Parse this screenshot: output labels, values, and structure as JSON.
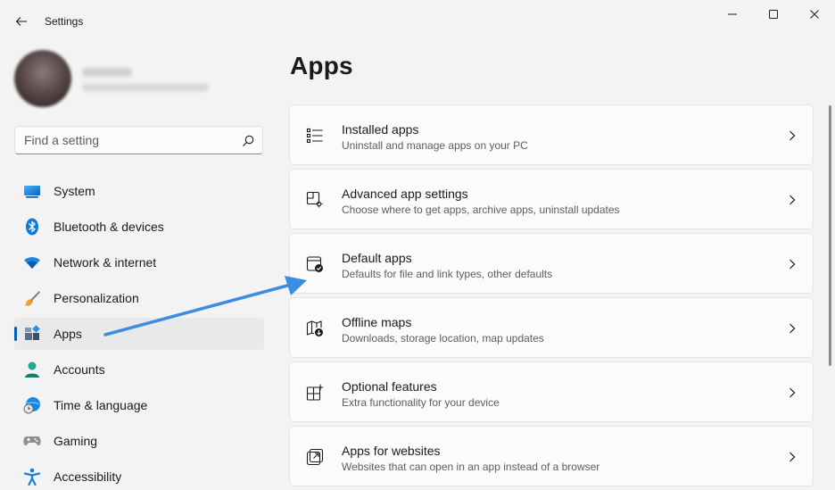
{
  "window": {
    "title": "Settings"
  },
  "search": {
    "placeholder": "Find a setting"
  },
  "sidebar": {
    "items": [
      {
        "label": "System",
        "icon": "monitor-icon"
      },
      {
        "label": "Bluetooth & devices",
        "icon": "bluetooth-icon"
      },
      {
        "label": "Network & internet",
        "icon": "wifi-icon"
      },
      {
        "label": "Personalization",
        "icon": "brush-icon"
      },
      {
        "label": "Apps",
        "icon": "apps-icon",
        "selected": true
      },
      {
        "label": "Accounts",
        "icon": "person-icon"
      },
      {
        "label": "Time & language",
        "icon": "globe-clock-icon"
      },
      {
        "label": "Gaming",
        "icon": "gamepad-icon"
      },
      {
        "label": "Accessibility",
        "icon": "accessibility-icon"
      }
    ]
  },
  "main": {
    "title": "Apps",
    "cards": [
      {
        "title": "Installed apps",
        "description": "Uninstall and manage apps on your PC",
        "icon": "list-icon"
      },
      {
        "title": "Advanced app settings",
        "description": "Choose where to get apps, archive apps, uninstall updates",
        "icon": "app-settings-icon"
      },
      {
        "title": "Default apps",
        "description": "Defaults for file and link types, other defaults",
        "icon": "default-apps-icon"
      },
      {
        "title": "Offline maps",
        "description": "Downloads, storage location, map updates",
        "icon": "map-download-icon"
      },
      {
        "title": "Optional features",
        "description": "Extra functionality for your device",
        "icon": "optional-features-icon"
      },
      {
        "title": "Apps for websites",
        "description": "Websites that can open in an app instead of a browser",
        "icon": "open-external-icon"
      }
    ]
  },
  "colors": {
    "accent": "#005fb8",
    "annotation_arrow": "#3a8de0",
    "background": "#f3f3f3",
    "card": "#fbfbfb"
  }
}
